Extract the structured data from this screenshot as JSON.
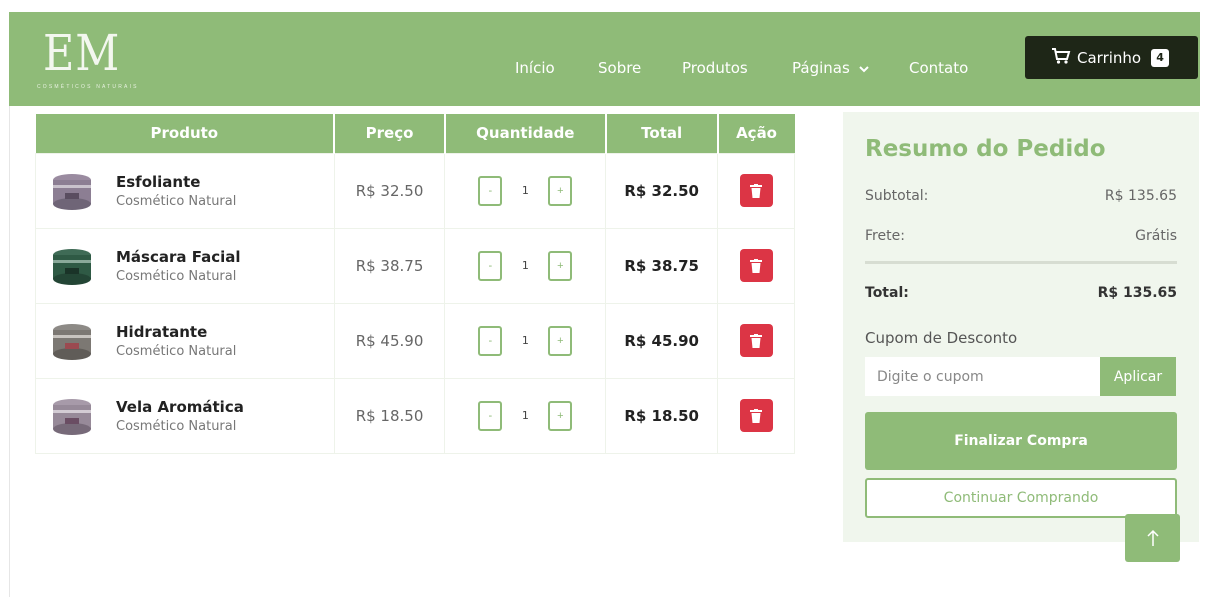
{
  "brand": {
    "logo_text": "EM",
    "logo_sub": "COSMÉTICOS NATURAIS"
  },
  "nav": {
    "links": [
      "Início",
      "Sobre",
      "Produtos",
      "Páginas",
      "Contato"
    ],
    "cart_label": "Carrinho",
    "cart_count": "4"
  },
  "table": {
    "headers": [
      "Produto",
      "Preço",
      "Quantidade",
      "Total",
      "Ação"
    ],
    "rows": [
      {
        "name": "Esfoliante",
        "category": "Cosmético Natural",
        "price": "R$ 32.50",
        "qty": "1",
        "total": "R$ 32.50",
        "minus": "-",
        "plus": "+"
      },
      {
        "name": "Máscara Facial",
        "category": "Cosmético Natural",
        "price": "R$ 38.75",
        "qty": "1",
        "total": "R$ 38.75",
        "minus": "-",
        "plus": "+"
      },
      {
        "name": "Hidratante",
        "category": "Cosmético Natural",
        "price": "R$ 45.90",
        "qty": "1",
        "total": "R$ 45.90",
        "minus": "-",
        "plus": "+"
      },
      {
        "name": "Vela Aromática",
        "category": "Cosmético Natural",
        "price": "R$ 18.50",
        "qty": "1",
        "total": "R$ 18.50",
        "minus": "-",
        "plus": "+"
      }
    ]
  },
  "summary": {
    "title": "Resumo do Pedido",
    "subtotal_label": "Subtotal:",
    "subtotal_value": "R$ 135.65",
    "shipping_label": "Frete:",
    "shipping_value": "Grátis",
    "total_label": "Total:",
    "total_value": "R$ 135.65",
    "coupon_label": "Cupom de Desconto",
    "coupon_placeholder": "Digite o cupom",
    "apply_label": "Aplicar",
    "checkout_label": "Finalizar Compra",
    "continue_label": "Continuar Comprando"
  },
  "colors": {
    "accent": "#8fbb78",
    "dark": "#1e2617",
    "danger": "#dc3545",
    "panel": "#f0f6ed"
  },
  "icons": [
    "cart-icon",
    "chevron-down-icon",
    "trash-icon",
    "arrow-up-icon"
  ]
}
